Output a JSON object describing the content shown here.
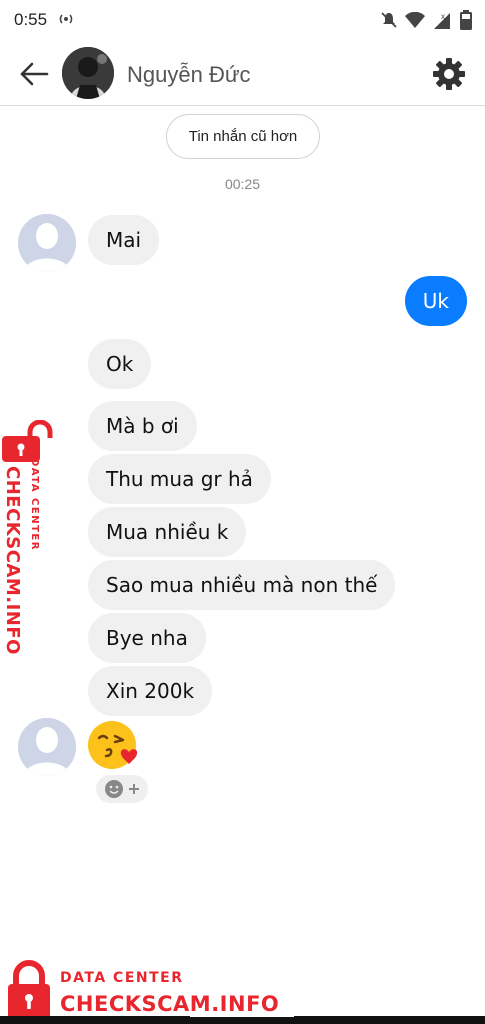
{
  "status_bar": {
    "time": "0:55",
    "icons": [
      "hotspot-icon",
      "silent-icon",
      "wifi-icon",
      "signal-icon",
      "battery-icon"
    ]
  },
  "header": {
    "contact_name": "Nguyễn Đức",
    "back_icon": "back-arrow-icon",
    "settings_icon": "gear-icon"
  },
  "older_messages_label": "Tin nhắn cũ hơn",
  "timestamp": "00:25",
  "messages": [
    {
      "text": "Mai",
      "direction": "in"
    },
    {
      "text": "Uk",
      "direction": "out"
    },
    {
      "text": "Ok",
      "direction": "in"
    },
    {
      "text": "Mà b ơi",
      "direction": "in"
    },
    {
      "text": "Thu mua gr hả",
      "direction": "in"
    },
    {
      "text": "Mua nhiều k",
      "direction": "in"
    },
    {
      "text": "Sao mua nhiều mà non thế",
      "direction": "in"
    },
    {
      "text": "Bye nha",
      "direction": "in"
    },
    {
      "text": "Xin 200k",
      "direction": "in"
    },
    {
      "text": "kissing-heart-emoji",
      "direction": "in"
    }
  ],
  "reaction_button_icon": "add-reaction-icon",
  "watermark": {
    "line1": "DATA CENTER",
    "line2": "CHECKSCAM.INFO",
    "color": "#e8262e"
  },
  "colors": {
    "outgoing_bubble": "#0a7cff",
    "incoming_bubble": "#f0f0f0"
  }
}
